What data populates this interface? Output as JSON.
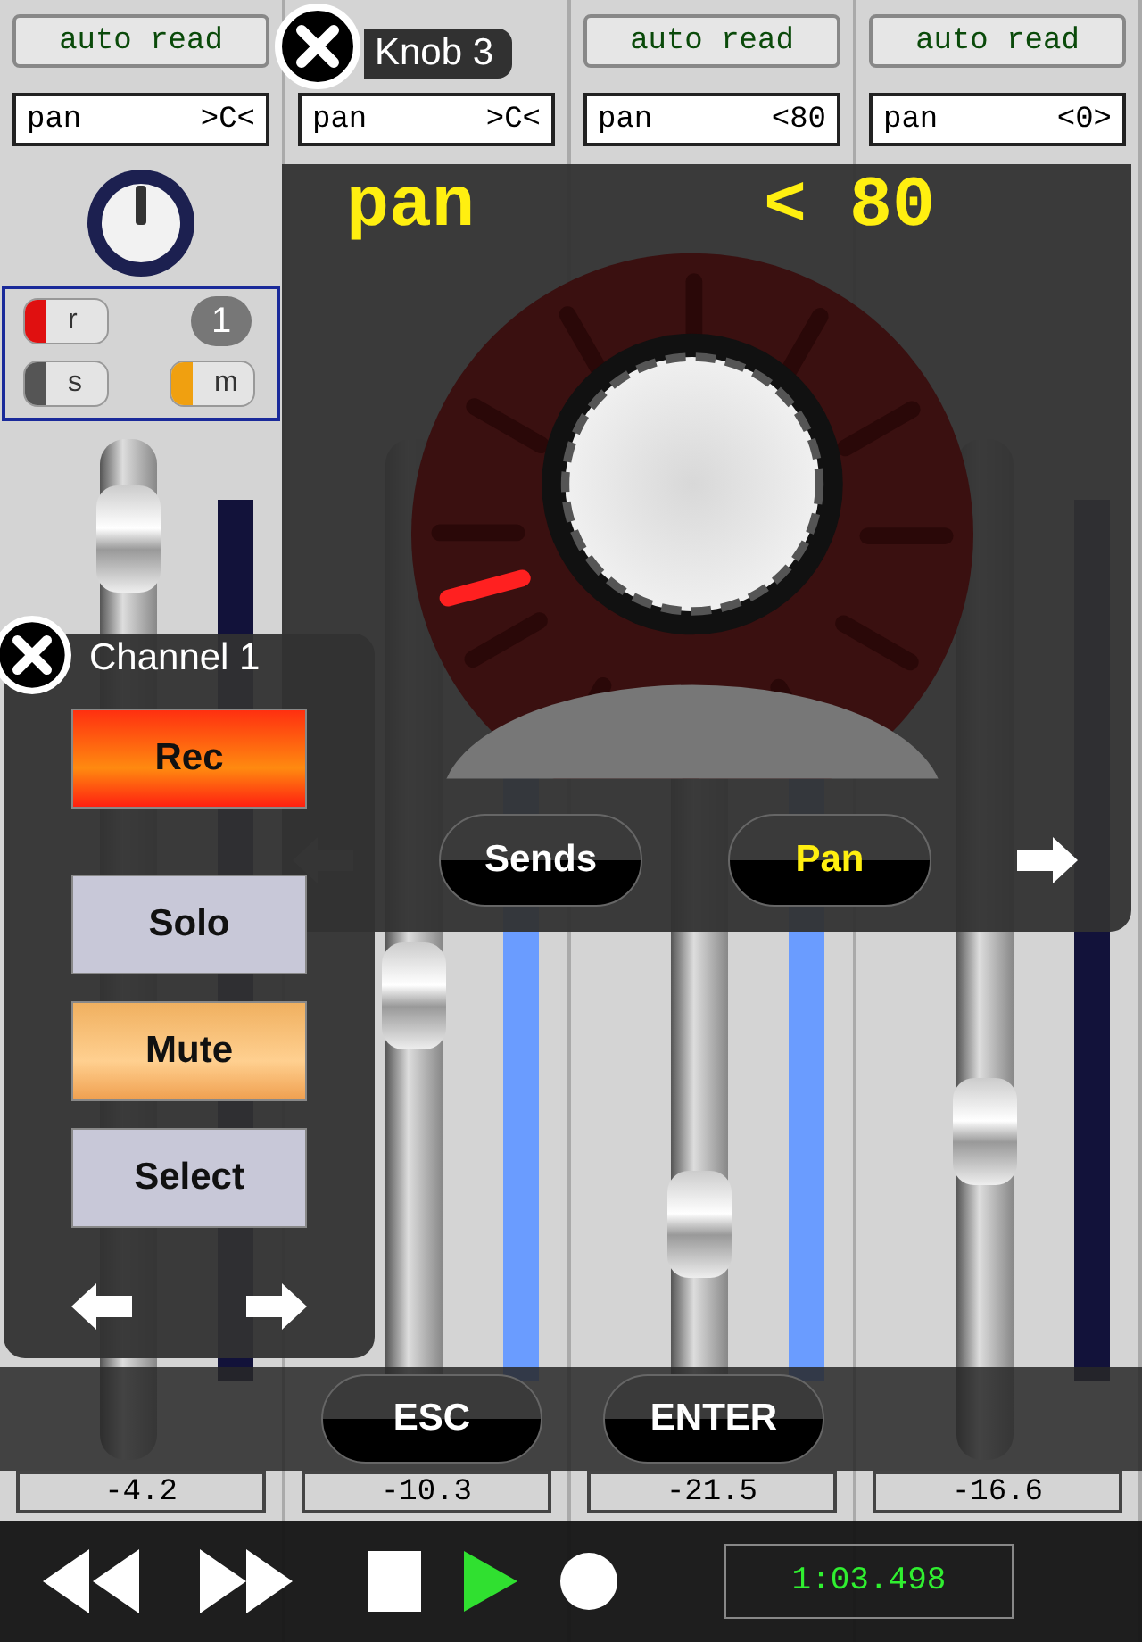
{
  "strips": [
    {
      "automation": "auto read",
      "pan_label": "pan",
      "pan_value": ">C<",
      "number": "1",
      "selected": true,
      "toggles": [
        {
          "label": "r",
          "kind": "record",
          "on": true
        },
        {
          "label": "s",
          "kind": "solo",
          "on": false
        },
        {
          "label": "m",
          "kind": "mute",
          "on": true
        }
      ],
      "fader": {
        "level": 0.95
      },
      "value": "-4.2"
    },
    {
      "pan_label": "pan",
      "pan_value": ">C<",
      "fader": {
        "level": 0.45
      },
      "meter": {
        "level": 0.75
      },
      "value": "-10.3"
    },
    {
      "automation": "auto read",
      "pan_label": "pan",
      "pan_value": "<80",
      "fader": {
        "level": 0.2
      },
      "meter": {
        "level": 0.75
      },
      "value": "-21.5"
    },
    {
      "automation": "auto read",
      "pan_label": "pan",
      "pan_value": "<0>",
      "fader": {
        "level": 0.3
      },
      "value": "-16.6"
    }
  ],
  "knob_popup": {
    "title": "Knob 3",
    "param": "pan",
    "reading": "< 80",
    "tabs": [
      {
        "label": "Sends",
        "selected": false
      },
      {
        "label": "Pan",
        "selected": true
      }
    ]
  },
  "channel_popup": {
    "title": "Channel 1",
    "buttons": [
      {
        "label": "Rec",
        "kind": "rec",
        "on": true
      },
      {
        "label": "Solo",
        "kind": "solo",
        "on": false
      },
      {
        "label": "Mute",
        "kind": "mute",
        "on": true
      },
      {
        "label": "Select",
        "kind": "select",
        "on": false
      }
    ]
  },
  "keys": [
    "ESC",
    "ENTER"
  ],
  "transport": {
    "playing": true,
    "time": "1:03.498"
  }
}
